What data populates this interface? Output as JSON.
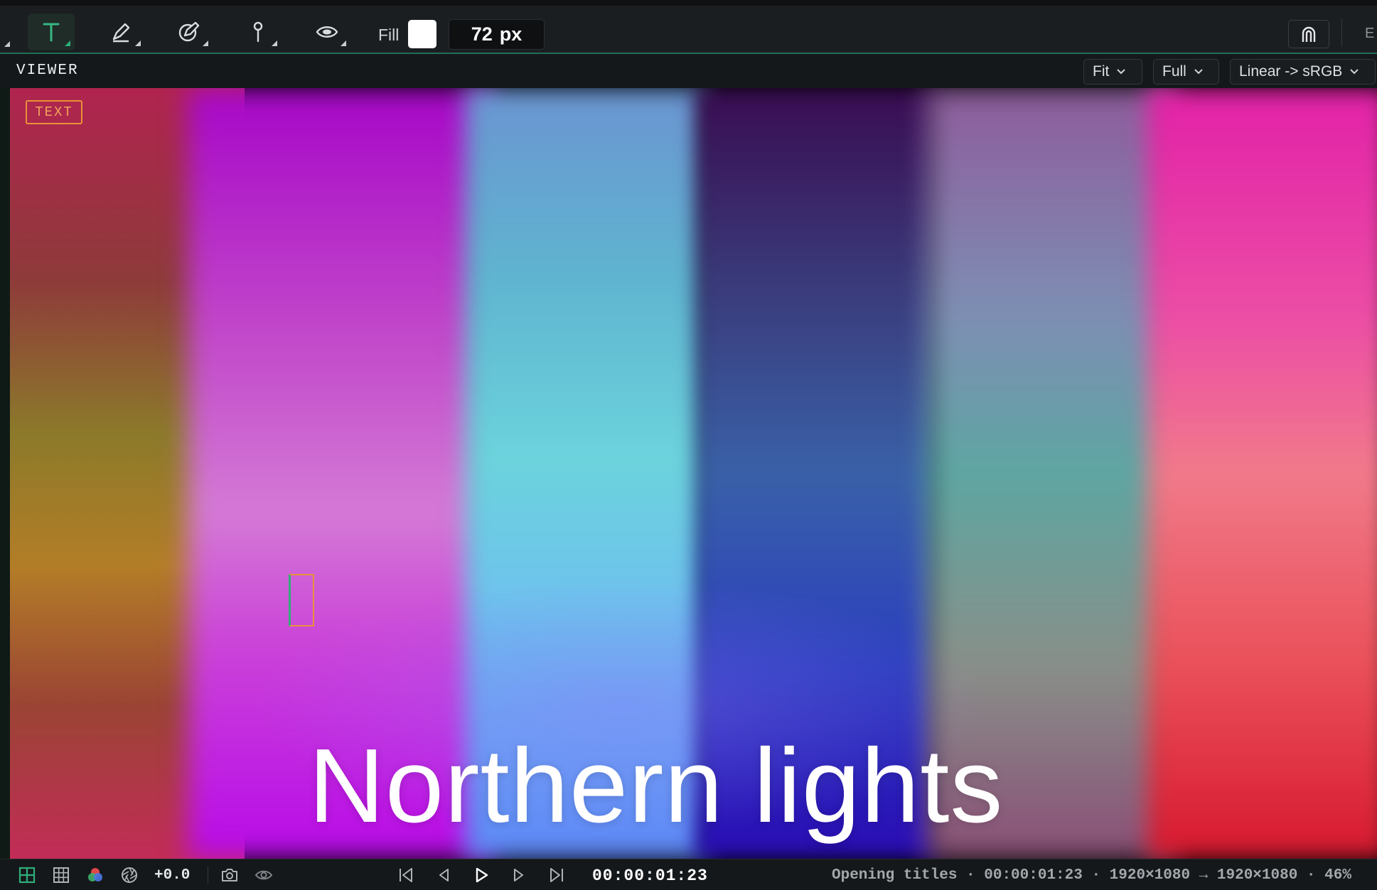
{
  "toolbar": {
    "tools": [
      {
        "name": "text-tool",
        "icon": "text-icon",
        "active": true
      },
      {
        "name": "pen-tool",
        "icon": "pen-icon"
      },
      {
        "name": "brush-tool",
        "icon": "brush-edit-icon"
      },
      {
        "name": "pin-tool",
        "icon": "pin-icon"
      },
      {
        "name": "view-tool",
        "icon": "eye-icon"
      }
    ],
    "fill_label": "Fill",
    "fill_color": "#ffffff",
    "size_value": "72",
    "size_unit": "px",
    "magnet_icon": "magnet-icon",
    "overflow_label": "E"
  },
  "viewer": {
    "title": "VIEWER",
    "zoom_mode": "Fit",
    "resolution": "Full",
    "color_transform": "Linear -> sRGB"
  },
  "canvas": {
    "badge": "TEXT",
    "title_text": "Northern lights",
    "accent_color": "#e8913a",
    "cursor_color": "#2fae7a"
  },
  "transport": {
    "icons": [
      "grid-icon",
      "table-icon",
      "color-channels-icon",
      "aperture-icon",
      "camera-icon",
      "eye-icon"
    ],
    "exposure": "+0.0",
    "controls": [
      "skip-to-start-icon",
      "step-back-icon",
      "play-icon",
      "step-forward-icon",
      "skip-to-end-icon"
    ],
    "timecode": "00:00:01:23",
    "status": "Opening titles · 00:00:01:23 · 1920×1080 → 1920×1080 · 46%"
  }
}
